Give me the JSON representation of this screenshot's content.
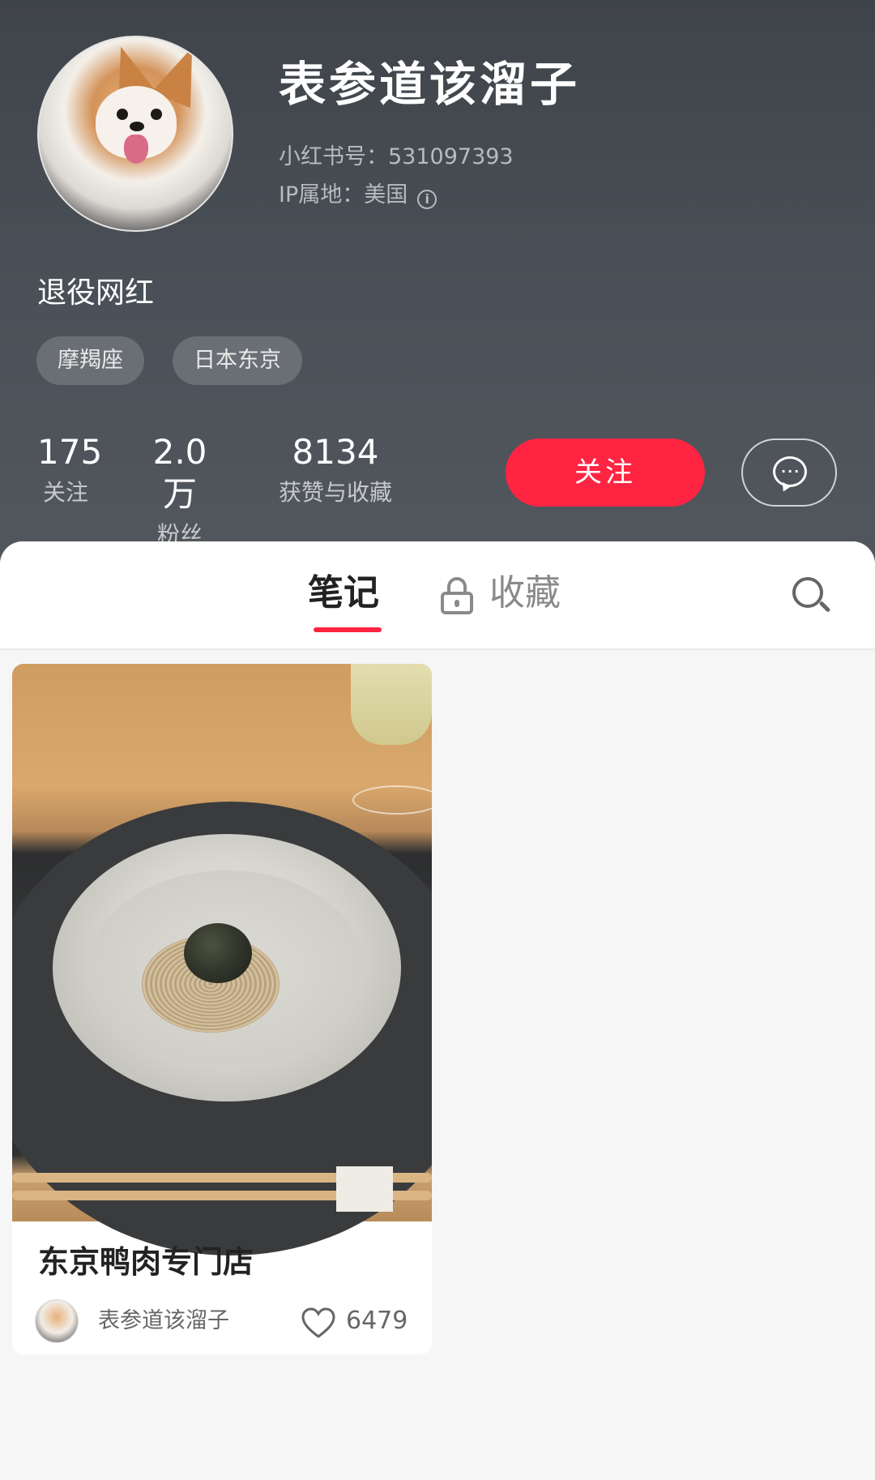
{
  "profile": {
    "name": "表参道该溜子",
    "id_text": "小红书号：531097393",
    "ip_text": "IP属地：美国",
    "bio": "退役网红",
    "tags": [
      "摩羯座",
      "日本东京"
    ]
  },
  "stats": [
    {
      "value": "175",
      "label": "关注"
    },
    {
      "value": "2.0万",
      "label": "粉丝"
    },
    {
      "value": "8134",
      "label": "获赞与收藏"
    }
  ],
  "actions": {
    "follow_label": "关注",
    "message_icon": "chat-bubble-icon"
  },
  "tabs": {
    "notes_label": "笔记",
    "collect_label": "收藏",
    "search_icon": "search-icon"
  },
  "colors": {
    "accent": "#ff2442",
    "header_bg": "#464b51"
  },
  "notes": [
    {
      "title": "东京鸭肉专门店",
      "author": "表参道该溜子",
      "likes": "6479"
    }
  ]
}
